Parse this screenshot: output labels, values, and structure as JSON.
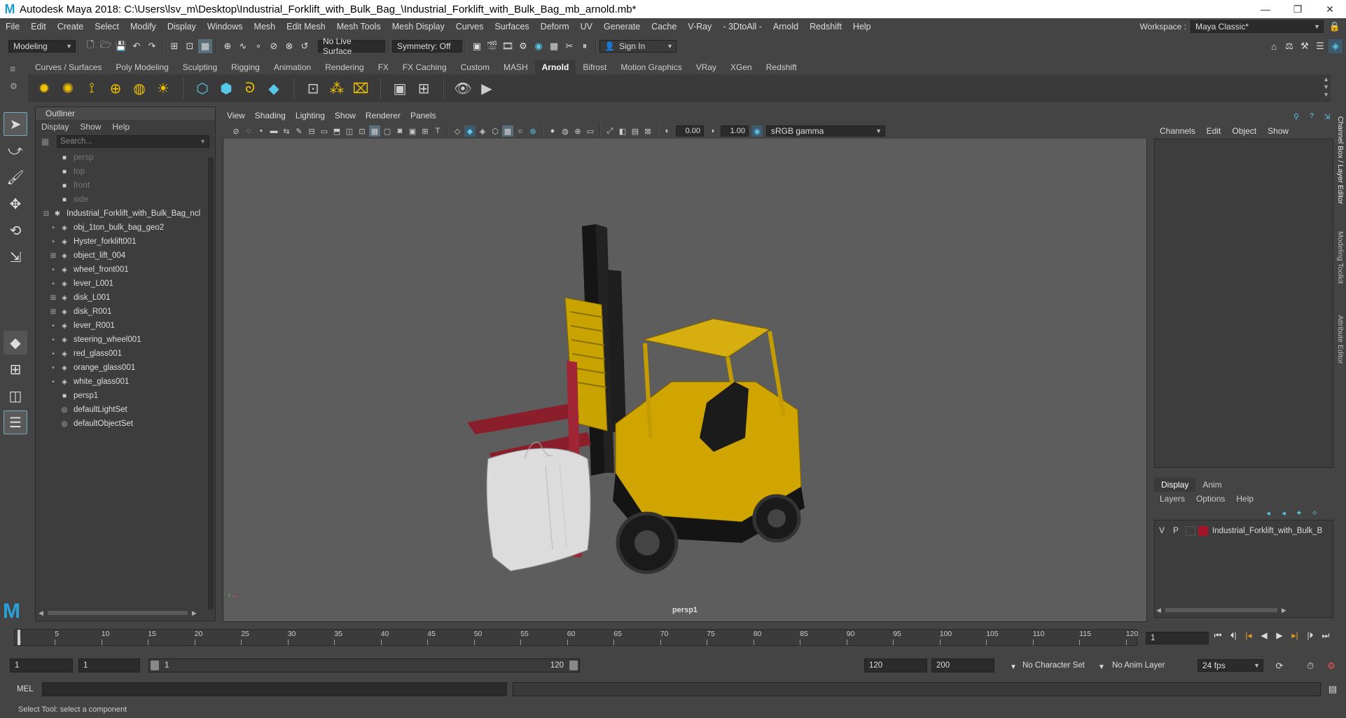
{
  "window": {
    "title": "Autodesk Maya 2018: C:\\Users\\lsv_m\\Desktop\\Industrial_Forklift_with_Bulk_Bag_\\Industrial_Forklift_with_Bulk_Bag_mb_arnold.mb*",
    "minimize": "—",
    "restore": "❐",
    "close": "✕"
  },
  "menubar": {
    "items": [
      "File",
      "Edit",
      "Create",
      "Select",
      "Modify",
      "Display",
      "Windows",
      "Mesh",
      "Edit Mesh",
      "Mesh Tools",
      "Mesh Display",
      "Curves",
      "Surfaces",
      "Deform",
      "UV",
      "Generate",
      "Cache",
      "V-Ray",
      "- 3DtoAll -",
      "Arnold",
      "Redshift",
      "Help"
    ],
    "workspace_label": "Workspace :",
    "workspace_value": "Maya Classic*"
  },
  "statusline": {
    "mode": "Modeling",
    "live_surface": "No Live Surface",
    "symmetry": "Symmetry: Off",
    "sign_in": "Sign In"
  },
  "shelf": {
    "tabs": [
      "Curves / Surfaces",
      "Poly Modeling",
      "Sculpting",
      "Rigging",
      "Animation",
      "Rendering",
      "FX",
      "FX Caching",
      "Custom",
      "MASH",
      "Arnold",
      "Bifrost",
      "Motion Graphics",
      "VRay",
      "XGen",
      "Redshift"
    ],
    "active_tab": "Arnold"
  },
  "outliner": {
    "title": "Outliner",
    "menu": [
      "Display",
      "Show",
      "Help"
    ],
    "search_placeholder": "Search...",
    "cameras": [
      "persp",
      "top",
      "front",
      "side"
    ],
    "group": "Industrial_Forklift_with_Bulk_Bag_ncl",
    "children": [
      {
        "name": "obj_1ton_bulk_bag_geo2",
        "expandable": false
      },
      {
        "name": "Hyster_forklift001",
        "expandable": false
      },
      {
        "name": "object_lift_004",
        "expandable": true
      },
      {
        "name": "wheel_front001",
        "expandable": false
      },
      {
        "name": "lever_L001",
        "expandable": false
      },
      {
        "name": "disk_L001",
        "expandable": true
      },
      {
        "name": "disk_R001",
        "expandable": true
      },
      {
        "name": "lever_R001",
        "expandable": false
      },
      {
        "name": "steering_wheel001",
        "expandable": false
      },
      {
        "name": "red_glass001",
        "expandable": false
      },
      {
        "name": "orange_glass001",
        "expandable": false
      },
      {
        "name": "white_glass001",
        "expandable": false
      }
    ],
    "after": [
      "persp1",
      "defaultLightSet",
      "defaultObjectSet"
    ]
  },
  "viewport": {
    "menu": [
      "View",
      "Shading",
      "Lighting",
      "Show",
      "Renderer",
      "Panels"
    ],
    "exposure": "0.00",
    "gamma": "1.00",
    "color_space": "sRGB gamma",
    "camera_label": "persp1"
  },
  "channelbox": {
    "menu": [
      "Channels",
      "Edit",
      "Object",
      "Show"
    ],
    "side_tabs": [
      "Channel Box / Layer Editor",
      "Modeling Toolkit",
      "Attribute Editor"
    ]
  },
  "layers": {
    "tabs": [
      "Display",
      "Anim"
    ],
    "active_tab": "Display",
    "menu": [
      "Layers",
      "Options",
      "Help"
    ],
    "rows": [
      {
        "v": "V",
        "p": "P",
        "name": "Industrial_Forklift_with_Bulk_B",
        "color": "#a6142a"
      }
    ]
  },
  "timeline": {
    "ticks": [
      "5",
      "10",
      "15",
      "20",
      "25",
      "30",
      "35",
      "40",
      "45",
      "50",
      "55",
      "60",
      "65",
      "70",
      "75",
      "80",
      "85",
      "90",
      "95",
      "100",
      "105",
      "110",
      "115",
      "120"
    ],
    "start_tick": "1",
    "current_frame": "1"
  },
  "range": {
    "start": "1",
    "playback_start": "1",
    "slider_start": "1",
    "slider_end": "120",
    "playback_end": "120",
    "end": "200",
    "character_set": "No Character Set",
    "anim_layer": "No Anim Layer",
    "fps": "24 fps"
  },
  "cmdline": {
    "label": "MEL"
  },
  "helpline": {
    "text": "Select Tool: select a component"
  }
}
